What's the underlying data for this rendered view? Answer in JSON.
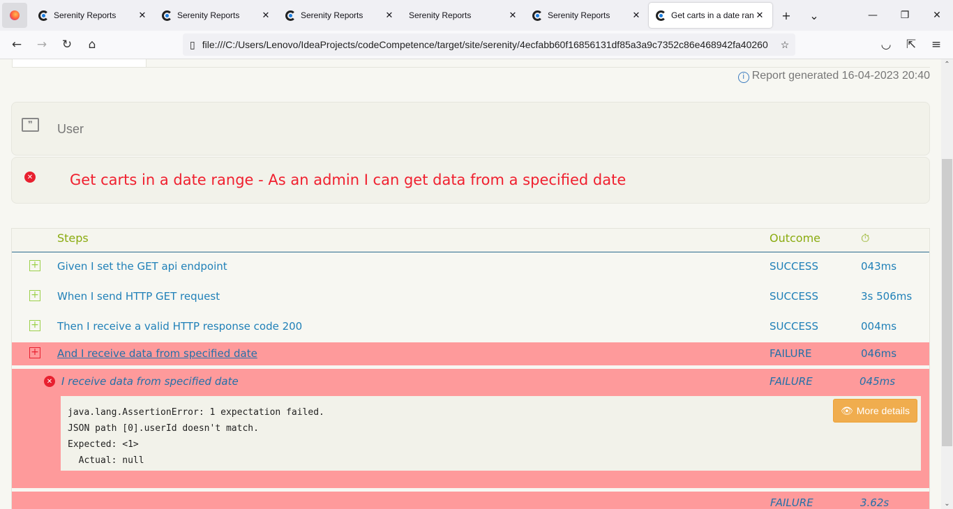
{
  "browser": {
    "tabs": [
      {
        "label": "Serenity Reports",
        "icon": true
      },
      {
        "label": "Serenity Reports",
        "icon": true
      },
      {
        "label": "Serenity Reports",
        "icon": true
      },
      {
        "label": "Serenity Reports",
        "icon": false
      },
      {
        "label": "Serenity Reports",
        "icon": true
      },
      {
        "label": "Get carts in a date range",
        "icon": true,
        "active": true
      }
    ],
    "url": "file:///C:/Users/Lenovo/IdeaProjects/codeCompetence/target/site/serenity/4ecfabb60f16856131df85a3a9c7352c86e468942fa40260"
  },
  "report": {
    "generated": "Report generated 16-04-2023 20:40",
    "feature": "User",
    "scenario": "Get carts in a date range - As an admin I can get data from a specified date",
    "headers": {
      "steps": "Steps",
      "outcome": "Outcome"
    },
    "steps": [
      {
        "text": "Given I set the GET api endpoint",
        "outcome": "SUCCESS",
        "duration": "043ms"
      },
      {
        "text": "When I send HTTP GET request",
        "outcome": "SUCCESS",
        "duration": "3s 506ms"
      },
      {
        "text": "Then I receive a valid HTTP response code 200",
        "outcome": "SUCCESS",
        "duration": "004ms"
      },
      {
        "text": "And I receive data from specified date",
        "outcome": "FAILURE",
        "duration": "046ms"
      }
    ],
    "substep": {
      "text": "I receive data from specified date",
      "outcome": "FAILURE",
      "duration": "045ms"
    },
    "error": "java.lang.AssertionError: 1 expectation failed.\nJSON path [0].userId doesn't match.\nExpected: <1>\n  Actual: null",
    "more_details": "More details",
    "total": {
      "outcome": "FAILURE",
      "duration": "3.62s"
    }
  },
  "colors": {
    "failure_bg": "#fe9a9b",
    "error_red": "#f0202f",
    "link_blue": "#2080b8",
    "header_green": "#8aab10",
    "button_orange": "#f0ad4e"
  }
}
